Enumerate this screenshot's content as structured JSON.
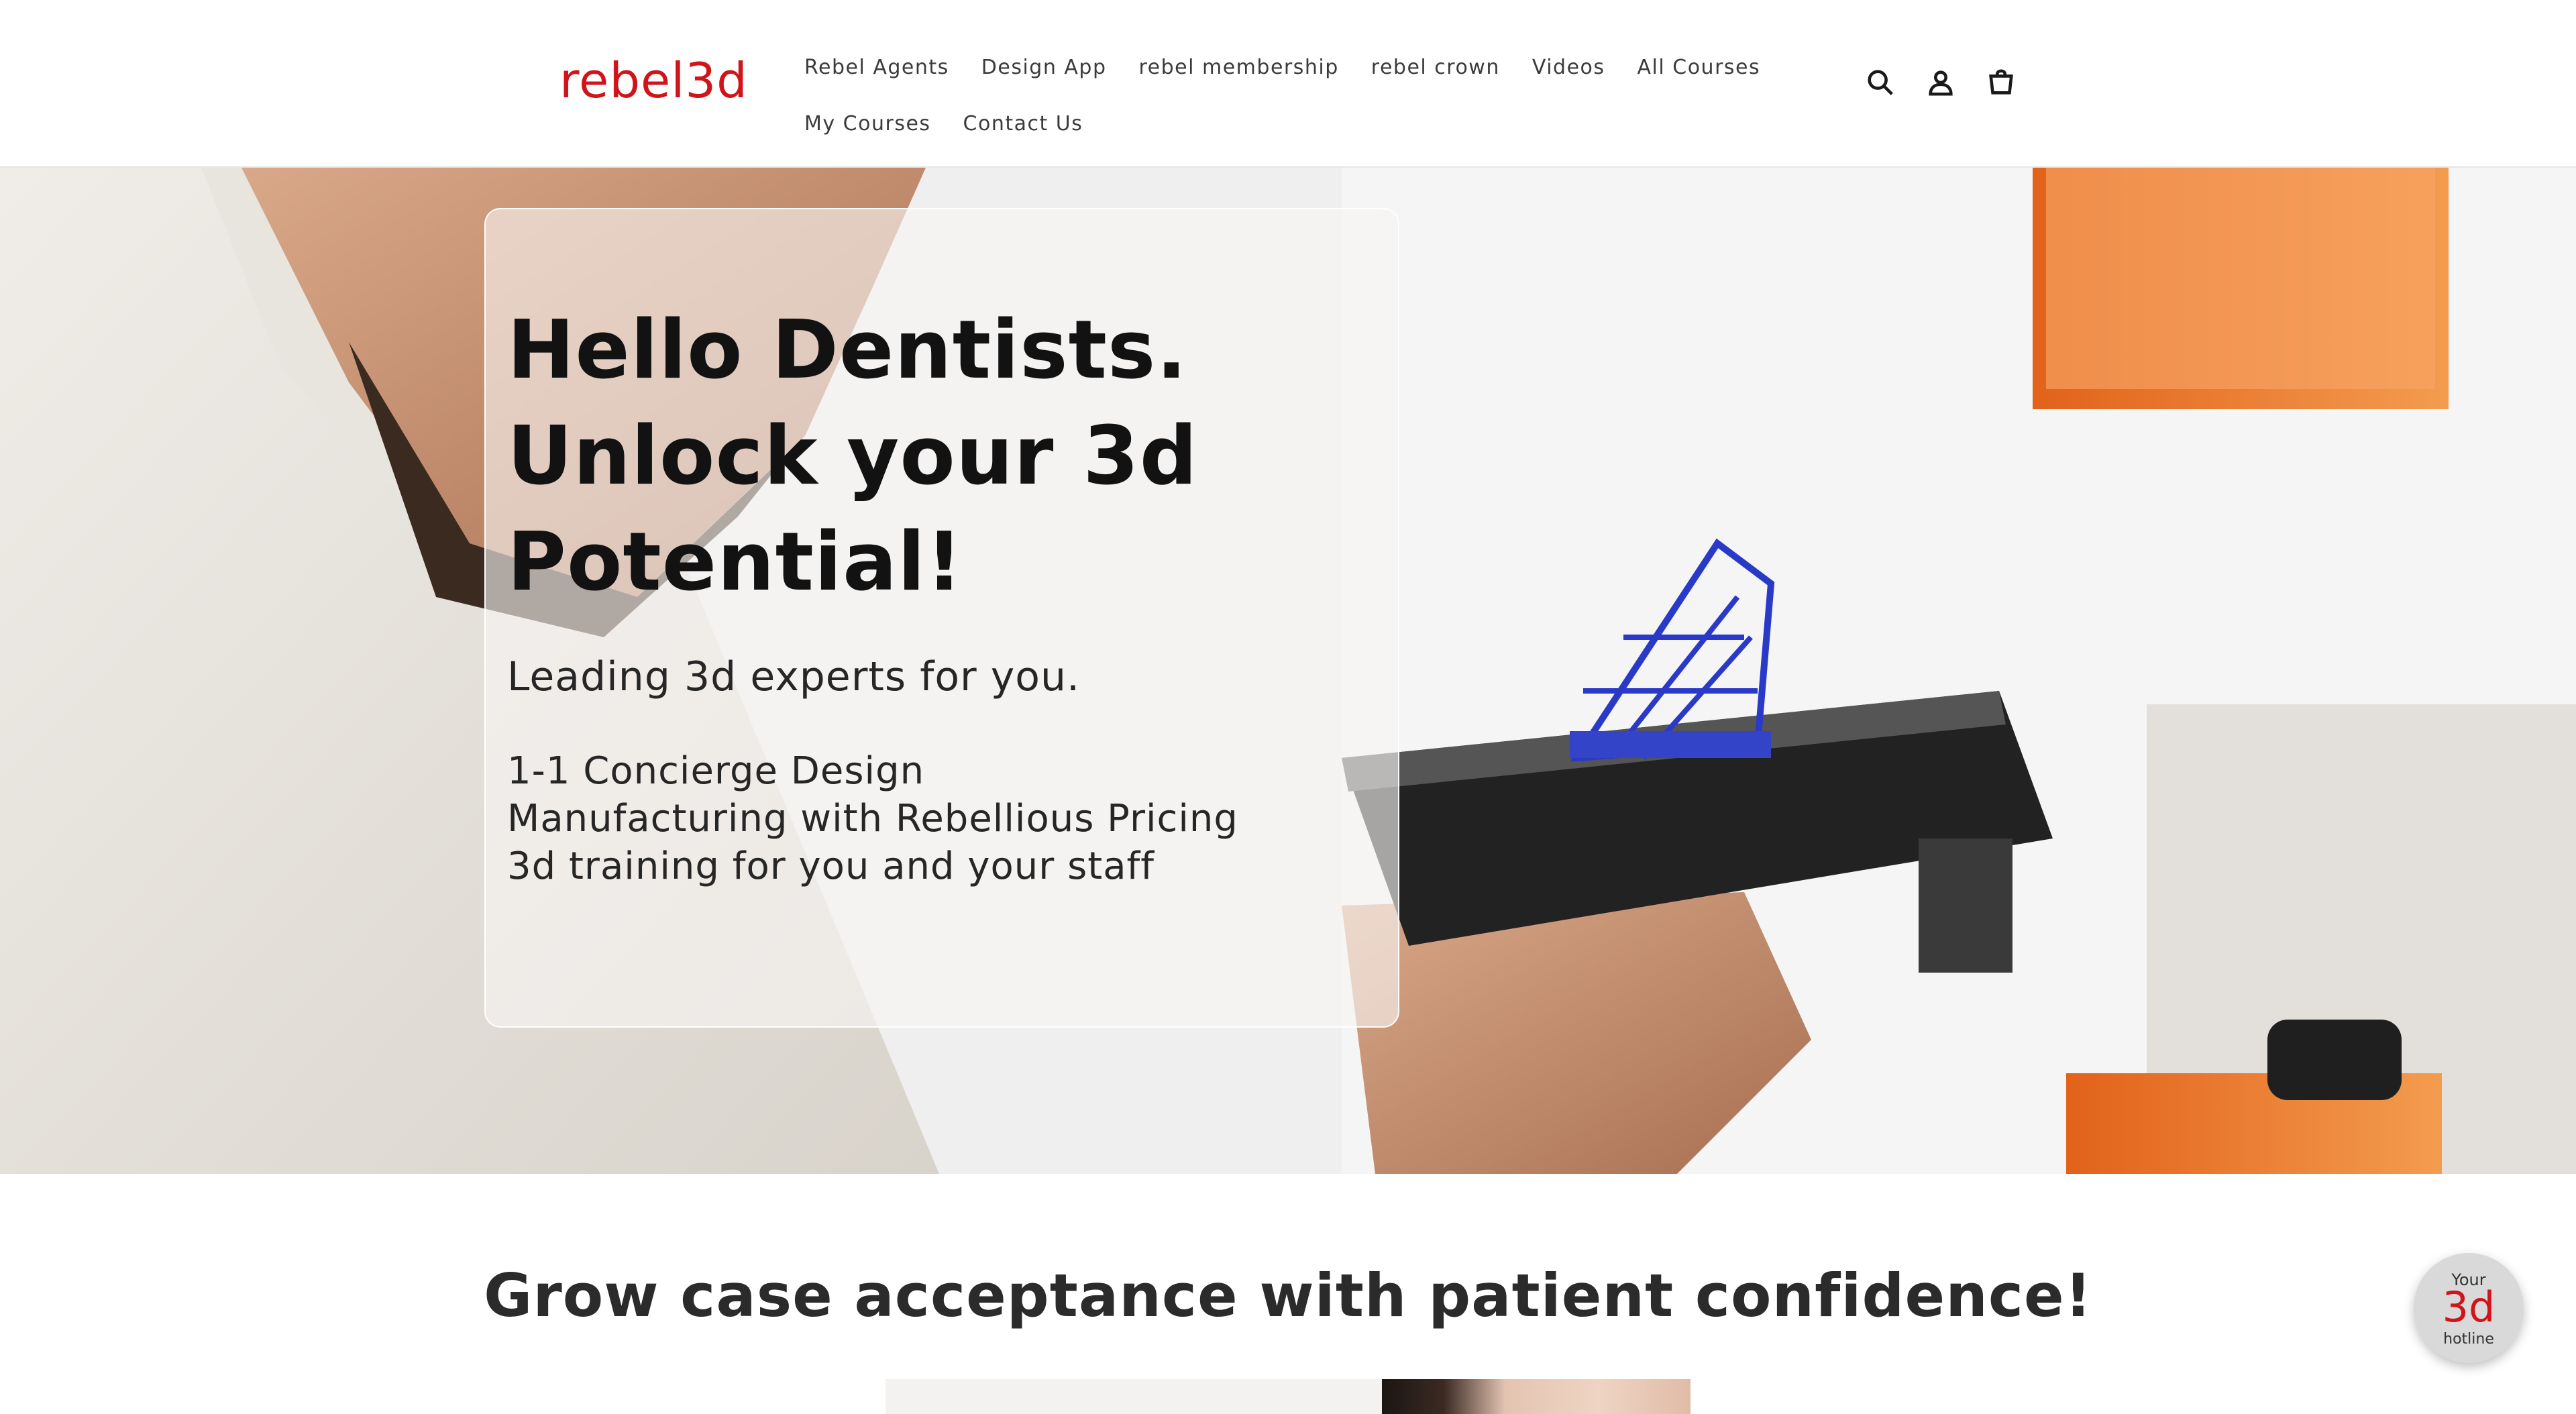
{
  "header": {
    "logo": "rebel3d",
    "nav_row1": [
      "Rebel Agents",
      "Design App",
      "rebel membership",
      "rebel crown",
      "Videos",
      "All Courses"
    ],
    "nav_row2": [
      "My Courses",
      "Contact Us"
    ],
    "icons": [
      "search-icon",
      "account-icon",
      "cart-icon"
    ]
  },
  "hero": {
    "title_lines": [
      "Hello Dentists.",
      "Unlock your 3d",
      "Potential!"
    ],
    "subtitle": "Leading 3d experts for you.",
    "list": [
      "1-1 Concierge Design",
      "Manufacturing with Rebellious Pricing",
      "3d training for you and your staff"
    ]
  },
  "section": {
    "title": "Grow case acceptance with patient confidence!"
  },
  "hotline": {
    "top": "Your",
    "middle": "3d",
    "bottom": "hotline"
  },
  "colors": {
    "brand_red": "#d0141a",
    "text_dark": "#121212"
  }
}
